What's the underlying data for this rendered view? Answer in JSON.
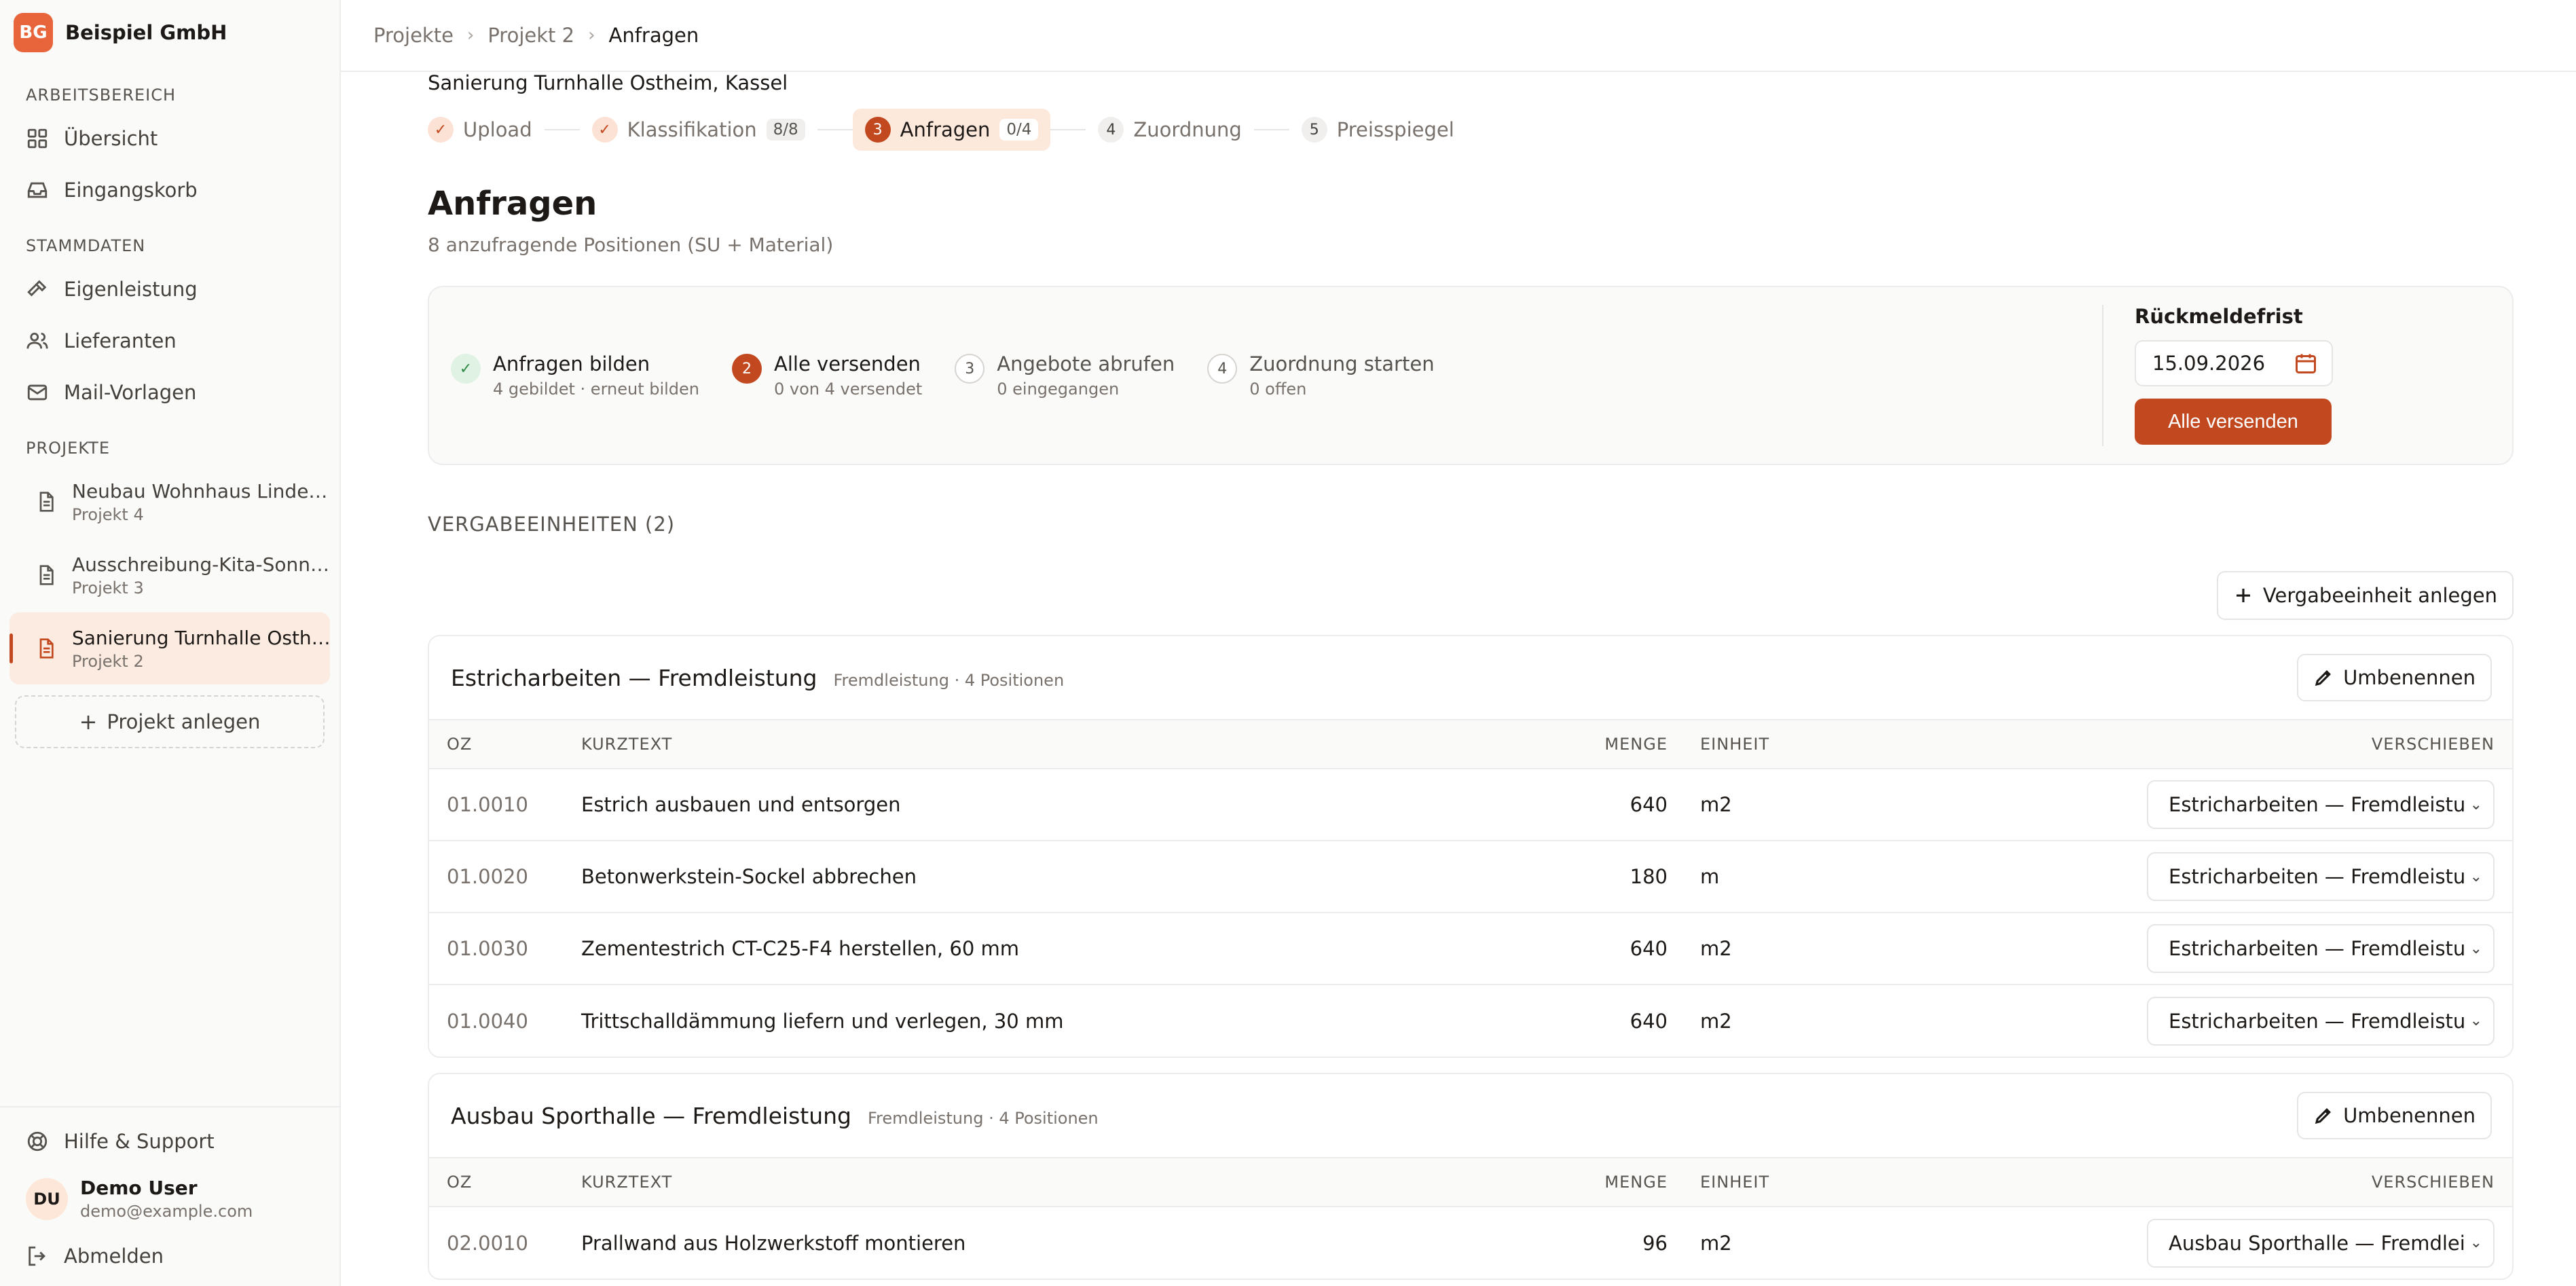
{
  "brand": {
    "logo": "BG",
    "name": "Beispiel GmbH"
  },
  "sidebar": {
    "sections": [
      {
        "label": "ARBEITSBEREICH",
        "items": [
          {
            "label": "Übersicht",
            "icon": "grid-icon"
          },
          {
            "label": "Eingangskorb",
            "icon": "inbox-icon"
          }
        ]
      },
      {
        "label": "STAMMDATEN",
        "items": [
          {
            "label": "Eigenleistung",
            "icon": "hammer-icon"
          },
          {
            "label": "Lieferanten",
            "icon": "users-icon"
          },
          {
            "label": "Mail-Vorlagen",
            "icon": "mail-icon"
          }
        ]
      }
    ],
    "projects_label": "PROJEKTE",
    "projects": [
      {
        "title": "Neubau Wohnhaus Linde…",
        "sub": "Projekt 4",
        "active": false
      },
      {
        "title": "Ausschreibung-Kita-Sonn…",
        "sub": "Projekt 3",
        "active": false
      },
      {
        "title": "Sanierung Turnhalle Osth…",
        "sub": "Projekt 2",
        "active": true
      }
    ],
    "add_project": "Projekt anlegen",
    "help": "Hilfe & Support",
    "user": {
      "initials": "DU",
      "name": "Demo User",
      "email": "demo@example.com"
    },
    "logout": "Abmelden"
  },
  "breadcrumb": [
    "Projekte",
    "Projekt 2",
    "Anfragen"
  ],
  "project_name": "Sanierung Turnhalle Ostheim, Kassel",
  "stepper": [
    {
      "label": "Upload",
      "state": "done",
      "badge": ""
    },
    {
      "label": "Klassifikation",
      "state": "done",
      "badge": "8/8"
    },
    {
      "num": "3",
      "label": "Anfragen",
      "state": "current",
      "badge": "0/4"
    },
    {
      "num": "4",
      "label": "Zuordnung",
      "state": "todo",
      "badge": ""
    },
    {
      "num": "5",
      "label": "Preisspiegel",
      "state": "todo",
      "badge": ""
    }
  ],
  "page": {
    "title": "Anfragen",
    "subtitle": "8 anzufragende Positionen (SU + Material)"
  },
  "process": {
    "steps": [
      {
        "num": "",
        "title": "Anfragen bilden",
        "sub": "4 gebildet",
        "link": "erneut bilden",
        "state": "done"
      },
      {
        "num": "2",
        "title": "Alle versenden",
        "sub": "0 von 4 versendet",
        "state": "current"
      },
      {
        "num": "3",
        "title": "Angebote abrufen",
        "sub": "0 eingegangen",
        "state": "todo"
      },
      {
        "num": "4",
        "title": "Zuordnung starten",
        "sub": "0 offen",
        "state": "todo"
      }
    ],
    "deadline_label": "Rückmeldefrist",
    "deadline_value": "15.09.2026",
    "send_all": "Alle versenden"
  },
  "units_label": "VERGABEEINHEITEN (2)",
  "add_unit": "Vergabeeinheit anlegen",
  "columns": {
    "oz": "OZ",
    "kurztext": "KURZTEXT",
    "menge": "MENGE",
    "einheit": "EINHEIT",
    "verschieben": "VERSCHIEBEN"
  },
  "rename_label": "Umbenennen",
  "units": [
    {
      "title": "Estricharbeiten — Fremdleistung",
      "meta": "Fremdleistung · 4 Positionen",
      "rows": [
        {
          "oz": "01.0010",
          "kurztext": "Estrich ausbauen und entsorgen",
          "menge": "640",
          "einheit": "m2",
          "move": "Estricharbeiten — Fremdleistung"
        },
        {
          "oz": "01.0020",
          "kurztext": "Betonwerkstein-Sockel abbrechen",
          "menge": "180",
          "einheit": "m",
          "move": "Estricharbeiten — Fremdleistung"
        },
        {
          "oz": "01.0030",
          "kurztext": "Zementestrich CT-C25-F4 herstellen, 60 mm",
          "menge": "640",
          "einheit": "m2",
          "move": "Estricharbeiten — Fremdleistung"
        },
        {
          "oz": "01.0040",
          "kurztext": "Trittschalldämmung liefern und verlegen, 30 mm",
          "menge": "640",
          "einheit": "m2",
          "move": "Estricharbeiten — Fremdleistung"
        }
      ]
    },
    {
      "title": "Ausbau Sporthalle — Fremdleistung",
      "meta": "Fremdleistung · 4 Positionen",
      "rows": [
        {
          "oz": "02.0010",
          "kurztext": "Prallwand aus Holzwerkstoff montieren",
          "menge": "96",
          "einheit": "m2",
          "move": "Ausbau Sporthalle — Fremdleistu"
        }
      ]
    }
  ],
  "colors": {
    "accent": "#c2491f",
    "brand": "#e8643a",
    "active_bg": "#fde8dc",
    "done_green": "#2e8a45"
  }
}
